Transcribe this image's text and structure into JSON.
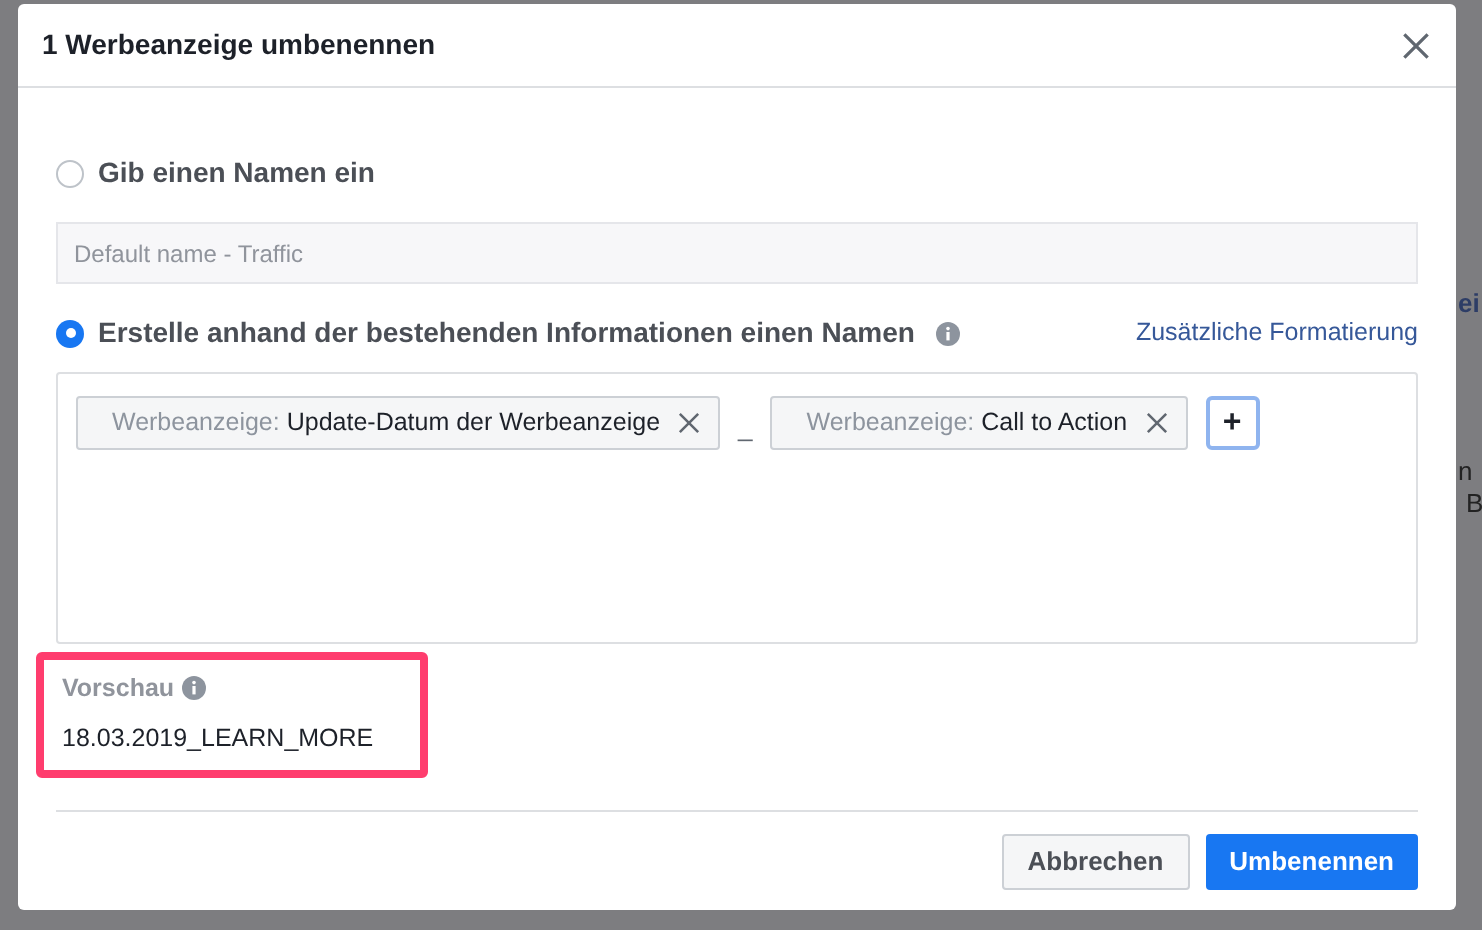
{
  "background": {
    "fragments": [
      {
        "kind": "link",
        "text": "ei"
      },
      {
        "kind": "text",
        "text": "n"
      },
      {
        "kind": "text",
        "text": "B"
      }
    ]
  },
  "dialog": {
    "title": "1 Werbeanzeige umbenennen",
    "options": [
      {
        "label": "Gib einen Namen ein",
        "selected": false,
        "info": false
      },
      {
        "label": "Erstelle anhand der bestehenden Informationen einen Namen",
        "selected": true,
        "info": true
      }
    ],
    "name_field": {
      "placeholder": "Default name - Traffic"
    },
    "formatting_link": "Zusätzliche Formatierung",
    "tokens": [
      {
        "prefix": "Werbeanzeige:",
        "value": "Update-Datum der Werbeanzeige"
      },
      {
        "prefix": "Werbeanzeige:",
        "value": "Call to Action"
      }
    ],
    "separator": "_",
    "add_button": "+",
    "preview": {
      "label": "Vorschau",
      "value": "18.03.2019_LEARN_MORE",
      "highlighted": true
    },
    "buttons": [
      {
        "label": "Abbrechen",
        "kind": "secondary"
      },
      {
        "label": "Umbenennen",
        "kind": "primary"
      }
    ]
  }
}
